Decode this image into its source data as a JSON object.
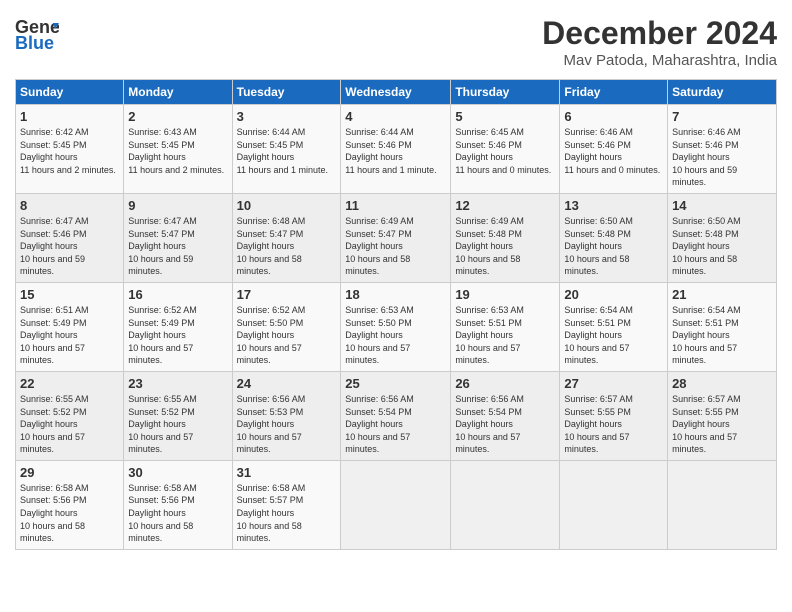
{
  "header": {
    "logo_general": "General",
    "logo_blue": "Blue",
    "month_title": "December 2024",
    "location": "Mav Patoda, Maharashtra, India"
  },
  "days_of_week": [
    "Sunday",
    "Monday",
    "Tuesday",
    "Wednesday",
    "Thursday",
    "Friday",
    "Saturday"
  ],
  "weeks": [
    [
      {
        "day": "1",
        "sunrise": "6:42 AM",
        "sunset": "5:45 PM",
        "daylight": "11 hours and 2 minutes."
      },
      {
        "day": "2",
        "sunrise": "6:43 AM",
        "sunset": "5:45 PM",
        "daylight": "11 hours and 2 minutes."
      },
      {
        "day": "3",
        "sunrise": "6:44 AM",
        "sunset": "5:45 PM",
        "daylight": "11 hours and 1 minute."
      },
      {
        "day": "4",
        "sunrise": "6:44 AM",
        "sunset": "5:46 PM",
        "daylight": "11 hours and 1 minute."
      },
      {
        "day": "5",
        "sunrise": "6:45 AM",
        "sunset": "5:46 PM",
        "daylight": "11 hours and 0 minutes."
      },
      {
        "day": "6",
        "sunrise": "6:46 AM",
        "sunset": "5:46 PM",
        "daylight": "11 hours and 0 minutes."
      },
      {
        "day": "7",
        "sunrise": "6:46 AM",
        "sunset": "5:46 PM",
        "daylight": "10 hours and 59 minutes."
      }
    ],
    [
      {
        "day": "8",
        "sunrise": "6:47 AM",
        "sunset": "5:46 PM",
        "daylight": "10 hours and 59 minutes."
      },
      {
        "day": "9",
        "sunrise": "6:47 AM",
        "sunset": "5:47 PM",
        "daylight": "10 hours and 59 minutes."
      },
      {
        "day": "10",
        "sunrise": "6:48 AM",
        "sunset": "5:47 PM",
        "daylight": "10 hours and 58 minutes."
      },
      {
        "day": "11",
        "sunrise": "6:49 AM",
        "sunset": "5:47 PM",
        "daylight": "10 hours and 58 minutes."
      },
      {
        "day": "12",
        "sunrise": "6:49 AM",
        "sunset": "5:48 PM",
        "daylight": "10 hours and 58 minutes."
      },
      {
        "day": "13",
        "sunrise": "6:50 AM",
        "sunset": "5:48 PM",
        "daylight": "10 hours and 58 minutes."
      },
      {
        "day": "14",
        "sunrise": "6:50 AM",
        "sunset": "5:48 PM",
        "daylight": "10 hours and 58 minutes."
      }
    ],
    [
      {
        "day": "15",
        "sunrise": "6:51 AM",
        "sunset": "5:49 PM",
        "daylight": "10 hours and 57 minutes."
      },
      {
        "day": "16",
        "sunrise": "6:52 AM",
        "sunset": "5:49 PM",
        "daylight": "10 hours and 57 minutes."
      },
      {
        "day": "17",
        "sunrise": "6:52 AM",
        "sunset": "5:50 PM",
        "daylight": "10 hours and 57 minutes."
      },
      {
        "day": "18",
        "sunrise": "6:53 AM",
        "sunset": "5:50 PM",
        "daylight": "10 hours and 57 minutes."
      },
      {
        "day": "19",
        "sunrise": "6:53 AM",
        "sunset": "5:51 PM",
        "daylight": "10 hours and 57 minutes."
      },
      {
        "day": "20",
        "sunrise": "6:54 AM",
        "sunset": "5:51 PM",
        "daylight": "10 hours and 57 minutes."
      },
      {
        "day": "21",
        "sunrise": "6:54 AM",
        "sunset": "5:51 PM",
        "daylight": "10 hours and 57 minutes."
      }
    ],
    [
      {
        "day": "22",
        "sunrise": "6:55 AM",
        "sunset": "5:52 PM",
        "daylight": "10 hours and 57 minutes."
      },
      {
        "day": "23",
        "sunrise": "6:55 AM",
        "sunset": "5:52 PM",
        "daylight": "10 hours and 57 minutes."
      },
      {
        "day": "24",
        "sunrise": "6:56 AM",
        "sunset": "5:53 PM",
        "daylight": "10 hours and 57 minutes."
      },
      {
        "day": "25",
        "sunrise": "6:56 AM",
        "sunset": "5:54 PM",
        "daylight": "10 hours and 57 minutes."
      },
      {
        "day": "26",
        "sunrise": "6:56 AM",
        "sunset": "5:54 PM",
        "daylight": "10 hours and 57 minutes."
      },
      {
        "day": "27",
        "sunrise": "6:57 AM",
        "sunset": "5:55 PM",
        "daylight": "10 hours and 57 minutes."
      },
      {
        "day": "28",
        "sunrise": "6:57 AM",
        "sunset": "5:55 PM",
        "daylight": "10 hours and 57 minutes."
      }
    ],
    [
      {
        "day": "29",
        "sunrise": "6:58 AM",
        "sunset": "5:56 PM",
        "daylight": "10 hours and 58 minutes."
      },
      {
        "day": "30",
        "sunrise": "6:58 AM",
        "sunset": "5:56 PM",
        "daylight": "10 hours and 58 minutes."
      },
      {
        "day": "31",
        "sunrise": "6:58 AM",
        "sunset": "5:57 PM",
        "daylight": "10 hours and 58 minutes."
      },
      null,
      null,
      null,
      null
    ]
  ]
}
